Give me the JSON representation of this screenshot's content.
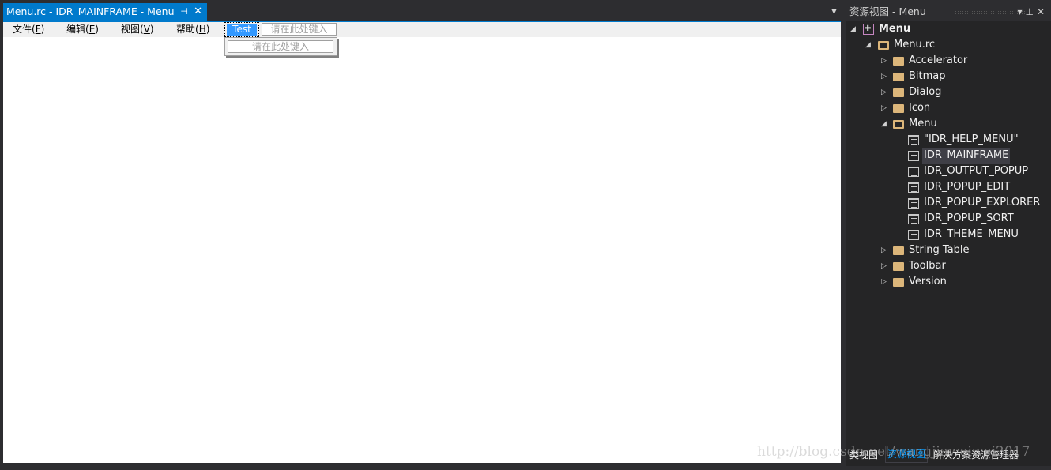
{
  "document_tab": {
    "title": "Menu.rc - IDR_MAINFRAME - Menu",
    "pin_icon": "pin-icon",
    "close_icon": "close-icon"
  },
  "tab_dropdown_icon": "chevron-down-icon",
  "menubar": {
    "items": [
      {
        "label": "文件(",
        "mnemonic": "F",
        "suffix": ")"
      },
      {
        "label": "编辑(",
        "mnemonic": "E",
        "suffix": ")"
      },
      {
        "label": "视图(",
        "mnemonic": "V",
        "suffix": ")"
      },
      {
        "label": "帮助(",
        "mnemonic": "H",
        "suffix": ")"
      }
    ],
    "selected_item": "Test",
    "type_here_top": "请在此处键入",
    "type_here_popup": "请在此处键入"
  },
  "resource_view": {
    "title": "资源视图 - Menu",
    "header_buttons": {
      "dropdown": "▾",
      "pin": "⊥",
      "close": "✕"
    },
    "tree": {
      "root": "Menu",
      "rc_file": "Menu.rc",
      "folders": [
        {
          "label": "Accelerator",
          "expanded": false
        },
        {
          "label": "Bitmap",
          "expanded": false
        },
        {
          "label": "Dialog",
          "expanded": false
        },
        {
          "label": "Icon",
          "expanded": false
        },
        {
          "label": "Menu",
          "expanded": true
        }
      ],
      "menu_items": [
        "\"IDR_HELP_MENU\"",
        "IDR_MAINFRAME",
        "IDR_OUTPUT_POPUP",
        "IDR_POPUP_EDIT",
        "IDR_POPUP_EXPLORER",
        "IDR_POPUP_SORT",
        "IDR_THEME_MENU"
      ],
      "selected_menu_item": "IDR_MAINFRAME",
      "folders_after": [
        {
          "label": "String Table",
          "expanded": false
        },
        {
          "label": "Toolbar",
          "expanded": false
        },
        {
          "label": "Version",
          "expanded": false
        }
      ]
    },
    "bottom_tabs": [
      {
        "label": "类视图",
        "active": false
      },
      {
        "label": "资源视图",
        "active": true
      },
      {
        "label": "解决方案资源管理器",
        "active": false
      }
    ]
  },
  "watermark": "http://blog.csdn.net/wangjiaweiwei2017",
  "colors": {
    "accent": "#007acc",
    "selection": "#3399ff",
    "folder": "#dcb67a",
    "panel_bg": "#252526",
    "frame_bg": "#2d2d30"
  }
}
